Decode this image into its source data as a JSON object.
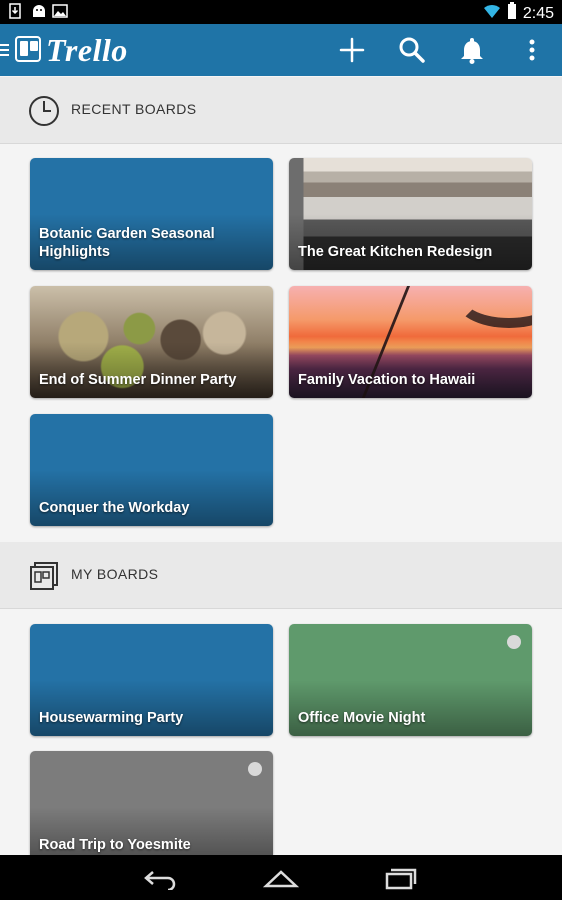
{
  "status_bar": {
    "time": "2:45",
    "icons": [
      "download-icon",
      "android-icon",
      "image-icon",
      "wifi-icon",
      "battery-icon"
    ]
  },
  "app_bar": {
    "brand": "Trello",
    "actions": [
      "menu-icon",
      "add-icon",
      "search-icon",
      "notifications-bell-icon",
      "overflow-menu-icon"
    ],
    "color": "#1f74a7"
  },
  "recent": {
    "title": "RECENT BOARDS",
    "boards": [
      {
        "name": "Botanic Garden Seasonal Highlights",
        "style": "blue"
      },
      {
        "name": "The Great Kitchen Redesign",
        "style": "photo-kitchen"
      },
      {
        "name": "End of Summer Dinner Party",
        "style": "photo-dessert"
      },
      {
        "name": "Family Vacation to Hawaii",
        "style": "photo-sunset"
      },
      {
        "name": "Conquer the Workday",
        "style": "blue"
      }
    ]
  },
  "my": {
    "title": "MY BOARDS",
    "boards": [
      {
        "name": "Housewarming Party",
        "style": "blue"
      },
      {
        "name": "Office Movie Night",
        "style": "green",
        "indicator": true
      },
      {
        "name": "Road Trip to Yoesmite",
        "style": "gray",
        "indicator": true
      }
    ]
  },
  "nav_bar": {
    "buttons": [
      "back-icon",
      "home-icon",
      "recent-apps-icon"
    ]
  }
}
